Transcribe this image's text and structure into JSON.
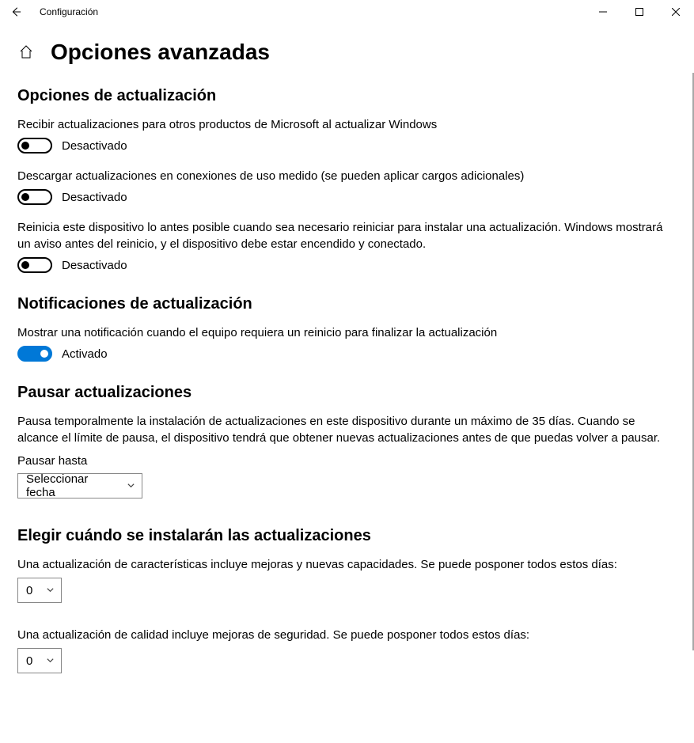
{
  "titlebar": {
    "title": "Configuración"
  },
  "header": {
    "page_title": "Opciones avanzadas"
  },
  "sections": {
    "update_options": {
      "heading": "Opciones de actualización",
      "items": [
        {
          "text": "Recibir actualizaciones para otros productos de Microsoft al actualizar Windows",
          "state_label": "Desactivado",
          "on": false
        },
        {
          "text": "Descargar actualizaciones en conexiones de uso medido (se pueden aplicar cargos adicionales)",
          "state_label": "Desactivado",
          "on": false
        },
        {
          "text": "Reinicia este dispositivo lo antes posible cuando sea necesario reiniciar para instalar una actualización. Windows mostrará un aviso antes del reinicio, y el dispositivo debe estar encendido y conectado.",
          "state_label": "Desactivado",
          "on": false
        }
      ]
    },
    "notifications": {
      "heading": "Notificaciones de actualización",
      "items": [
        {
          "text": "Mostrar una notificación cuando el equipo requiera un reinicio para finalizar la actualización",
          "state_label": "Activado",
          "on": true
        }
      ]
    },
    "pause": {
      "heading": "Pausar actualizaciones",
      "desc": "Pausa temporalmente la instalación de actualizaciones en este dispositivo durante un máximo de 35 días. Cuando se alcance el límite de pausa, el dispositivo tendrá que obtener nuevas actualizaciones antes de que puedas volver a pausar.",
      "label": "Pausar hasta",
      "select_value": "Seleccionar fecha"
    },
    "choose_when": {
      "heading": "Elegir cuándo se instalarán las actualizaciones",
      "feature_text": "Una actualización de características incluye mejoras y nuevas capacidades. Se puede posponer todos estos días:",
      "feature_value": "0",
      "quality_text": "Una actualización de calidad incluye mejoras de seguridad. Se puede posponer todos estos días:",
      "quality_value": "0"
    }
  },
  "colors": {
    "accent": "#0078d7"
  }
}
